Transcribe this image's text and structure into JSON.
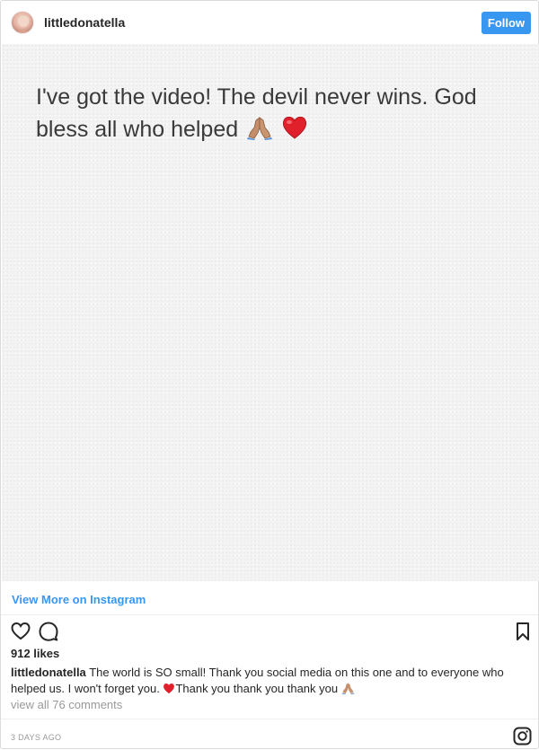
{
  "header": {
    "username": "littledonatella",
    "follow_label": "Follow",
    "avatar_icon": "profile-photo"
  },
  "media": {
    "text": "I've got the video! The devil never wins. God bless all who helped",
    "emojis": [
      "folded-hands-icon",
      "red-heart-icon"
    ],
    "background": "#f3f3f3"
  },
  "view_more": {
    "label": "View More on Instagram"
  },
  "actions": {
    "icons": [
      "heart-icon",
      "comment-icon",
      "bookmark-icon"
    ]
  },
  "likes": {
    "label": "912 likes"
  },
  "caption": {
    "username": "littledonatella",
    "text_part1": "The world is SO small! Thank you social media on this one and to everyone who helped us. I won't forget you.",
    "text_part2": "Thank you thank you thank you"
  },
  "comments": {
    "label": "view all 76 comments"
  },
  "footer": {
    "timestamp": "3 DAYS AGO",
    "logo_icon": "instagram-glyph-icon"
  },
  "colors": {
    "accent": "#3897f0",
    "text": "#262626",
    "muted": "#999999",
    "border": "#dbdbdb"
  }
}
